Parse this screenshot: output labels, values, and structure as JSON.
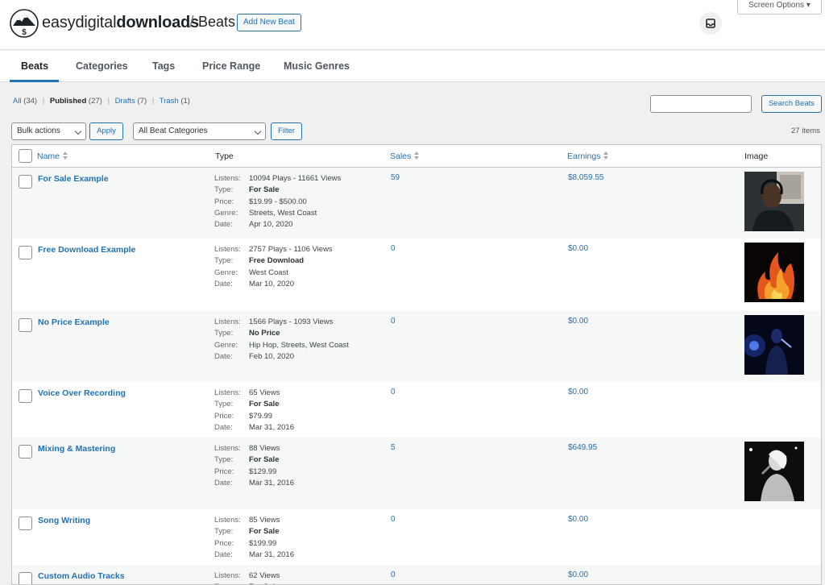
{
  "header": {
    "brand_light": "easy",
    "brand_mid": "digital",
    "brand_bold": "downloads",
    "separator": "/",
    "page_title": "Beats",
    "add_new_label": "Add New Beat",
    "screen_options_label": "Screen Options ▾"
  },
  "tabs": [
    {
      "label": "Beats",
      "active": true
    },
    {
      "label": "Categories"
    },
    {
      "label": "Tags"
    },
    {
      "label": "Price Range"
    },
    {
      "label": "Music Genres"
    }
  ],
  "status_filters": [
    {
      "label": "All",
      "count": "(34)"
    },
    {
      "label": "Published",
      "count": "(27)",
      "current": true
    },
    {
      "label": "Drafts",
      "count": "(7)"
    },
    {
      "label": "Trash",
      "count": "(1)"
    }
  ],
  "search": {
    "placeholder": "",
    "button_label": "Search Beats"
  },
  "bulk": {
    "selected": "Bulk actions",
    "apply_label": "Apply"
  },
  "category_filter": {
    "selected": "All Beat Categories",
    "filter_label": "Filter"
  },
  "items_count": "27 items",
  "columns": {
    "name": "Name",
    "type": "Type",
    "sales": "Sales",
    "earnings": "Earnings",
    "image": "Image"
  },
  "rows": [
    {
      "name": "For Sale Example",
      "sales": "59",
      "earnings": "$8,059.55",
      "image": "portrait-man-headphones",
      "meta": [
        [
          "Listens:",
          "10094 Plays - 11661 Views"
        ],
        [
          "Type:",
          "For Sale",
          true
        ],
        [
          "Price:",
          "$19.99 - $500.00"
        ],
        [
          "Genre:",
          "Streets, West Coast"
        ],
        [
          "Date:",
          "Apr 10, 2020"
        ]
      ]
    },
    {
      "name": "Free Download Example",
      "sales": "0",
      "earnings": "$0.00",
      "image": "fire",
      "meta": [
        [
          "Listens:",
          "2757 Plays - 1106 Views"
        ],
        [
          "Type:",
          "Free Download",
          true
        ],
        [
          "Genre:",
          "West Coast"
        ],
        [
          "Date:",
          "Mar 10, 2020"
        ]
      ]
    },
    {
      "name": "No Price Example",
      "sales": "0",
      "earnings": "$0.00",
      "image": "singer-blue-stage",
      "meta": [
        [
          "Listens:",
          "1566 Plays - 1093 Views"
        ],
        [
          "Type:",
          "No Price",
          true
        ],
        [
          "Genre:",
          "Hip Hop, Streets, West Coast"
        ],
        [
          "Date:",
          "Feb 10, 2020"
        ]
      ]
    },
    {
      "name": "Voice Over Recording",
      "sales": "0",
      "earnings": "$0.00",
      "image": "",
      "meta": [
        [
          "Listens:",
          "65 Views"
        ],
        [
          "Type:",
          "For Sale",
          true
        ],
        [
          "Price:",
          "$79.99"
        ],
        [
          "Date:",
          "Mar 31, 2016"
        ]
      ]
    },
    {
      "name": "Mixing & Mastering",
      "sales": "5",
      "earnings": "$649.95",
      "image": "singer-microphone-bw",
      "meta": [
        [
          "Listens:",
          "88 Views"
        ],
        [
          "Type:",
          "For Sale",
          true
        ],
        [
          "Price:",
          "$129.99"
        ],
        [
          "Date:",
          "Mar 31, 2016"
        ]
      ]
    },
    {
      "name": "Song Writing",
      "sales": "0",
      "earnings": "$0.00",
      "image": "",
      "meta": [
        [
          "Listens:",
          "85 Views"
        ],
        [
          "Type:",
          "For Sale",
          true
        ],
        [
          "Price:",
          "$199.99"
        ],
        [
          "Date:",
          "Mar 31, 2016"
        ]
      ]
    },
    {
      "name": "Custom Audio Tracks",
      "sales": "0",
      "earnings": "$0.00",
      "image": "",
      "meta": [
        [
          "Listens:",
          "62 Views"
        ],
        [
          "Type:",
          "For Sale",
          true
        ]
      ]
    }
  ],
  "colors": {
    "link": "#2271b1",
    "text": "#1d2327",
    "bg": "#f0f0f1",
    "row_alt": "#f6f7f7"
  }
}
